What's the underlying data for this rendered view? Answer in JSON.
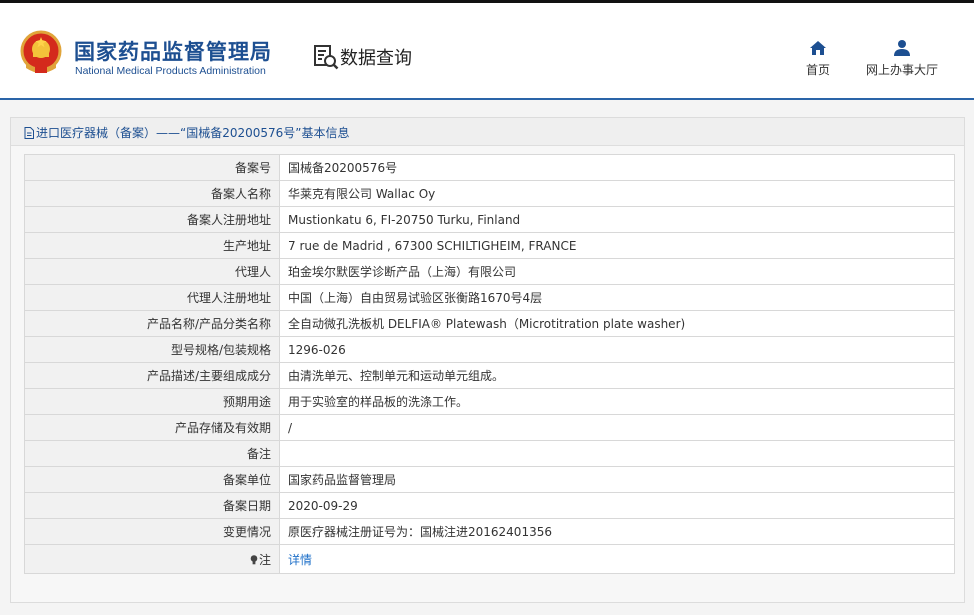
{
  "header": {
    "brand_cn": "国家药品监督管理局",
    "brand_en": "National Medical Products Administration",
    "query_title": "数据查询",
    "nav": [
      {
        "label": "首页",
        "icon": "home-icon"
      },
      {
        "label": "网上办事大厅",
        "icon": "user-icon"
      }
    ]
  },
  "panel": {
    "title": "进口医疗器械（备案）——“国械备20200576号”基本信息"
  },
  "records": [
    {
      "label": "备案号",
      "value": "国械备20200576号"
    },
    {
      "label": "备案人名称",
      "value": "华莱克有限公司 Wallac Oy"
    },
    {
      "label": "备案人注册地址",
      "value": "Mustionkatu 6, FI-20750 Turku, Finland"
    },
    {
      "label": "生产地址",
      "value": "7 rue de Madrid , 67300 SCHILTIGHEIM, FRANCE"
    },
    {
      "label": "代理人",
      "value": "珀金埃尔默医学诊断产品（上海）有限公司"
    },
    {
      "label": "代理人注册地址",
      "value": "中国（上海）自由贸易试验区张衡路1670号4层"
    },
    {
      "label": "产品名称/产品分类名称",
      "value": "全自动微孔洗板机 DELFIA® Platewash（Microtitration plate washer)"
    },
    {
      "label": "型号规格/包装规格",
      "value": "1296-026"
    },
    {
      "label": "产品描述/主要组成成分",
      "value": "由清洗单元、控制单元和运动单元组成。"
    },
    {
      "label": "预期用途",
      "value": "用于实验室的样品板的洗涤工作。"
    },
    {
      "label": "产品存储及有效期",
      "value": "/"
    },
    {
      "label": "备注",
      "value": ""
    },
    {
      "label": "备案单位",
      "value": "国家药品监督管理局"
    },
    {
      "label": "备案日期",
      "value": "2020-09-29"
    },
    {
      "label": "变更情况",
      "value": "原医疗器械注册证号为：国械注进20162401356"
    },
    {
      "label": "注",
      "value": "详情",
      "icon": "bulb-icon"
    }
  ],
  "colors": {
    "brand": "#1d4f91",
    "link": "#1d6fc8",
    "header_line": "#2a64a8"
  }
}
